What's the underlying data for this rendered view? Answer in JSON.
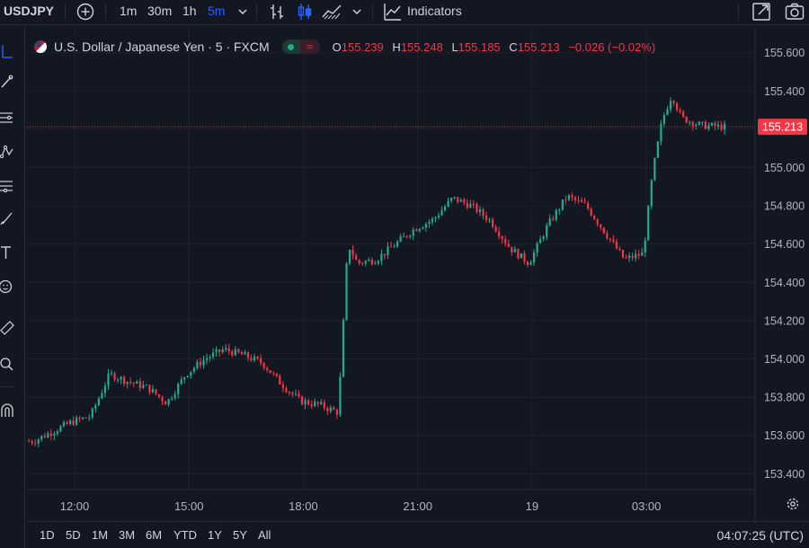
{
  "toolbar": {
    "symbol": "USDJPY",
    "intervals": [
      {
        "label": "1m",
        "active": false
      },
      {
        "label": "30m",
        "active": false
      },
      {
        "label": "1h",
        "active": false
      },
      {
        "label": "5m",
        "active": true
      }
    ],
    "indicators_label": "Indicators"
  },
  "legend": {
    "title": "U.S. Dollar / Japanese Yen · 5 · FXCM",
    "open_key": "O",
    "open": "155.239",
    "high_key": "H",
    "high": "155.248",
    "low_key": "L",
    "low": "155.185",
    "close_key": "C",
    "close": "155.213",
    "change": "−0.026 (−0.02%)"
  },
  "price_axis": {
    "labels": [
      "155.600",
      "155.400",
      "155.200",
      "155.000",
      "154.800",
      "154.600",
      "154.400",
      "154.200",
      "154.000",
      "153.800",
      "153.600",
      "153.400"
    ],
    "current_price": "155.213"
  },
  "time_axis": {
    "labels": [
      "12:00",
      "15:00",
      "18:00",
      "21:00",
      "19",
      "03:00"
    ]
  },
  "bottom": {
    "ranges": [
      "1D",
      "5D",
      "1M",
      "3M",
      "6M",
      "YTD",
      "1Y",
      "5Y",
      "All"
    ],
    "clock": "04:07:25 (UTC)"
  },
  "colors": {
    "up": "#22ab94",
    "down": "#f23645",
    "background": "#131722",
    "grid": "#1e222d",
    "accent": "#2962ff"
  },
  "chart_data": {
    "type": "candlestick",
    "symbol": "USDJPY",
    "ylim": [
      153.35,
      155.65
    ],
    "y_ticks": [
      153.4,
      153.6,
      153.8,
      154.0,
      154.2,
      154.4,
      154.6,
      154.8,
      155.0,
      155.2,
      155.4,
      155.6
    ],
    "x_ticks": [
      "12:00",
      "15:00",
      "18:00",
      "21:00",
      "19",
      "03:00"
    ],
    "current_price": 155.213,
    "series": [
      {
        "name": "close",
        "x_hours": [
          11,
          11.5,
          12,
          12.5,
          13,
          13.5,
          14,
          14.5,
          15,
          15.5,
          16,
          16.5,
          17,
          17.5,
          18,
          18.5,
          19,
          19.25,
          19.5,
          20,
          20.5,
          21,
          21.5,
          22,
          22.5,
          23,
          23.5,
          24,
          24.5,
          25,
          25.5,
          26,
          26.5,
          27,
          27.25,
          27.5,
          27.75,
          28,
          28.5,
          29
        ],
        "values": [
          153.57,
          153.62,
          153.67,
          153.7,
          153.92,
          153.88,
          153.85,
          153.77,
          153.92,
          154.0,
          154.05,
          154.02,
          153.98,
          153.87,
          153.78,
          153.76,
          153.72,
          154.6,
          154.5,
          154.52,
          154.6,
          154.68,
          154.73,
          154.84,
          154.8,
          154.72,
          154.58,
          154.5,
          154.7,
          154.85,
          154.8,
          154.66,
          154.52,
          154.55,
          154.98,
          155.25,
          155.38,
          155.26,
          155.22,
          155.213
        ]
      }
    ]
  }
}
